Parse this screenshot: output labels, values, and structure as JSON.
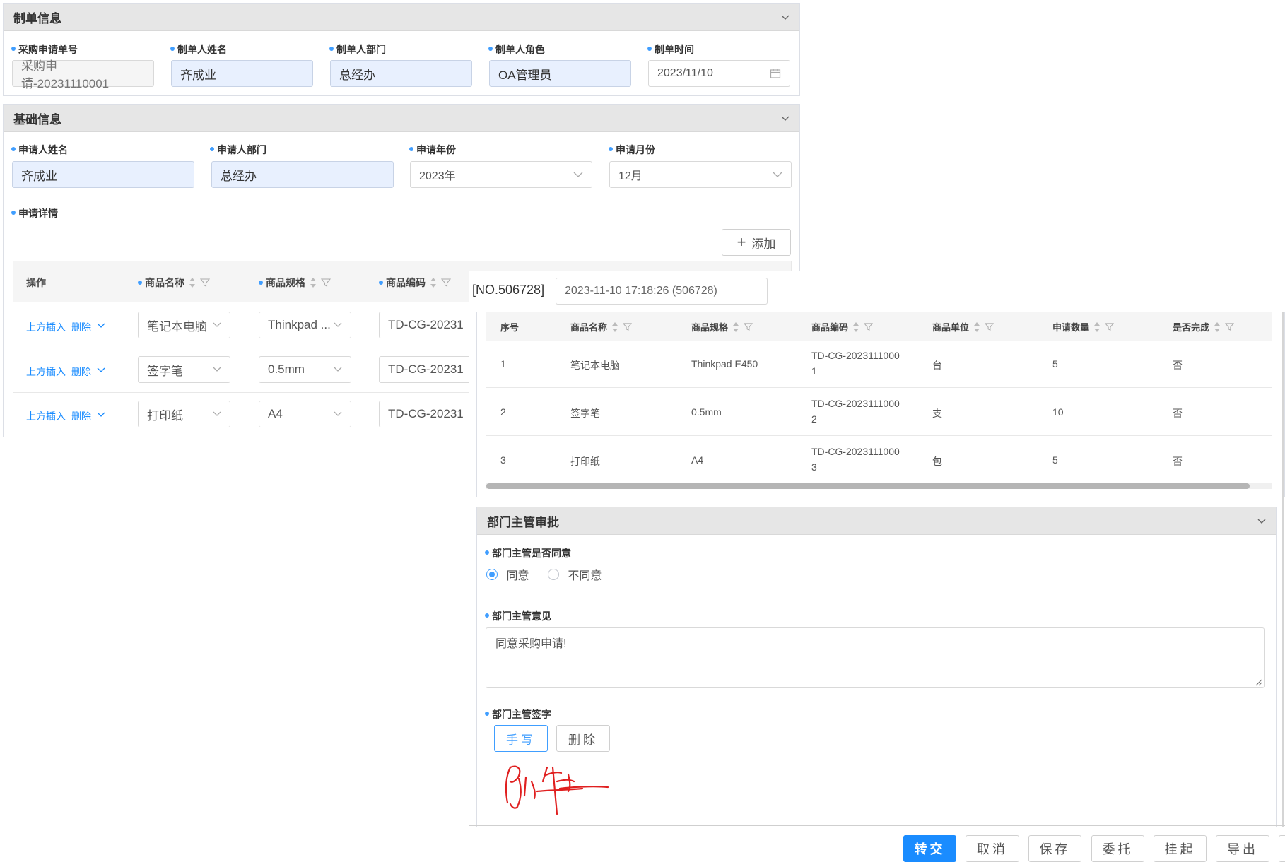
{
  "producer_section": {
    "title": "制单信息",
    "fields": [
      {
        "label": "采购申请单号",
        "value": "采购申请-20231110001"
      },
      {
        "label": "制单人姓名",
        "value": "齐成业"
      },
      {
        "label": "制单人部门",
        "value": "总经办"
      },
      {
        "label": "制单人角色",
        "value": "OA管理员"
      },
      {
        "label": "制单时间",
        "value": "2023/11/10"
      }
    ]
  },
  "basic_section": {
    "title": "基础信息",
    "applicant_name": {
      "label": "申请人姓名",
      "value": "齐成业"
    },
    "applicant_dept": {
      "label": "申请人部门",
      "value": "总经办"
    },
    "apply_year": {
      "label": "申请年份",
      "value": "2023年"
    },
    "apply_month": {
      "label": "申请月份",
      "value": "12月"
    },
    "detail_label": "申请详情",
    "add_button": "添加",
    "edit_table": {
      "headers": [
        "操作",
        "商品名称",
        "商品规格",
        "商品编码"
      ],
      "rows": [
        {
          "insert": "上方插入",
          "delete": "删除",
          "name": "笔记本电脑",
          "spec": "Thinkpad ...",
          "code": "TD-CG-20231"
        },
        {
          "insert": "上方插入",
          "delete": "删除",
          "name": "签字笔",
          "spec": "0.5mm",
          "code": "TD-CG-20231"
        },
        {
          "insert": "上方插入",
          "delete": "删除",
          "name": "打印纸",
          "spec": "A4",
          "code": "TD-CG-20231"
        }
      ]
    }
  },
  "record": {
    "number": "[NO.506728]",
    "timestamp": "2023-11-10 17:18:26 (506728)"
  },
  "view_table": {
    "headers": [
      "序号",
      "商品名称",
      "商品规格",
      "商品编码",
      "商品单位",
      "申请数量",
      "是否完成"
    ],
    "rows": [
      {
        "no": "1",
        "name": "笔记本电脑",
        "spec": "Thinkpad E450",
        "code1": "TD-CG-2023111000",
        "code2": "1",
        "unit": "台",
        "qty": "5",
        "done": "否"
      },
      {
        "no": "2",
        "name": "签字笔",
        "spec": "0.5mm",
        "code1": "TD-CG-2023111000",
        "code2": "2",
        "unit": "支",
        "qty": "10",
        "done": "否"
      },
      {
        "no": "3",
        "name": "打印纸",
        "spec": "A4",
        "code1": "TD-CG-2023111000",
        "code2": "3",
        "unit": "包",
        "qty": "5",
        "done": "否"
      }
    ]
  },
  "approval": {
    "title": "部门主管审批",
    "agree_label": "部门主管是否同意",
    "option_yes": "同意",
    "option_no": "不同意",
    "opinion_label": "部门主管意见",
    "opinion_value": "同意采购申请!",
    "sign_label": "部门主管签字",
    "handwrite_button": "手写",
    "delete_button": "删除"
  },
  "footer": {
    "submit": "转交",
    "cancel": "取消",
    "save": "保存",
    "delegate": "委托",
    "suspend": "挂起",
    "export": "导出"
  },
  "colors": {
    "accent": "#1a8cff",
    "signature": "#e02020"
  }
}
